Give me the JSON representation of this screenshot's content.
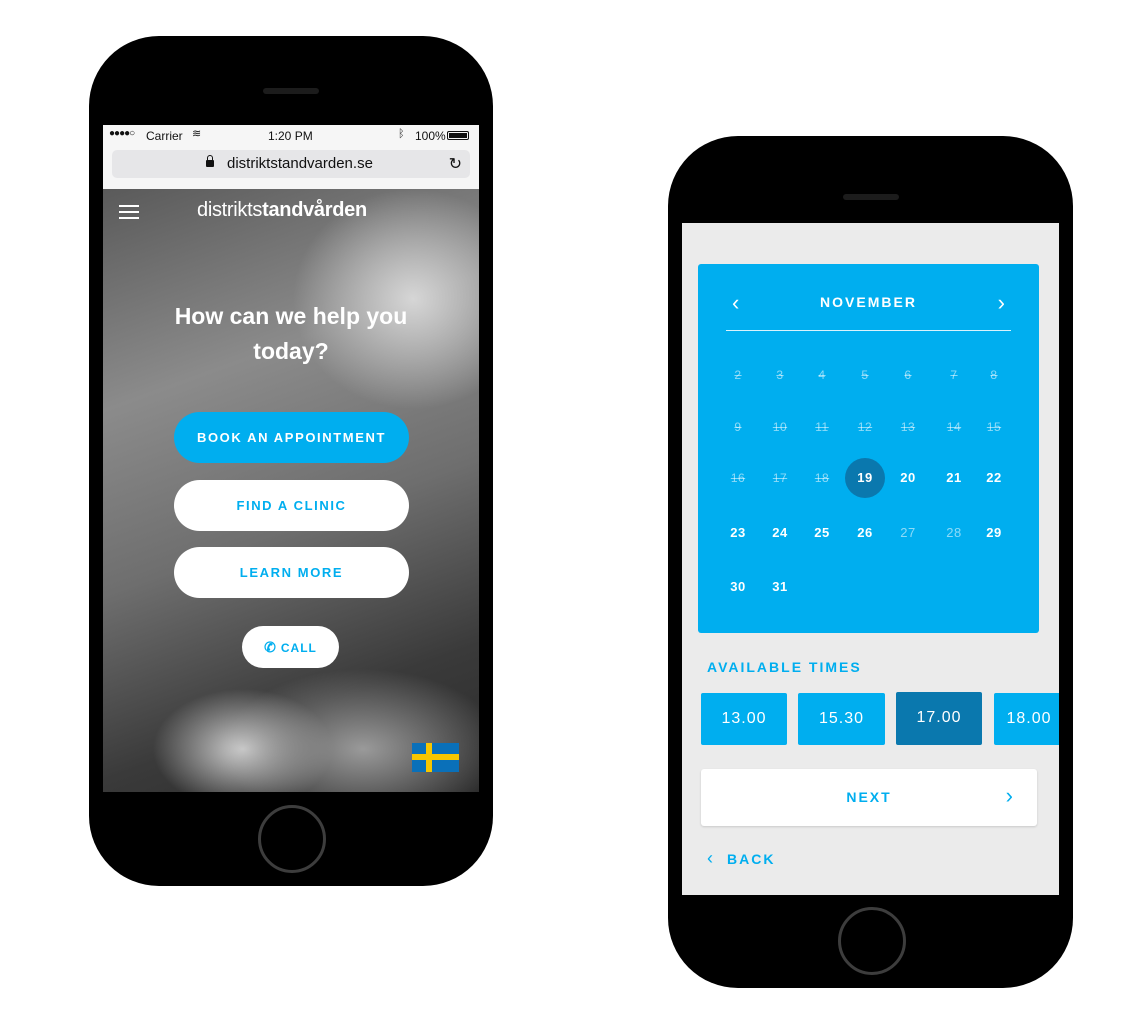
{
  "phone1": {
    "status_bar": {
      "signal": "●●●●○",
      "carrier": "Carrier",
      "wifi_icon": "wifi-icon",
      "time": "1:20 PM",
      "bluetooth_icon": "bluetooth-icon",
      "battery": "100%"
    },
    "browser": {
      "url": "distriktstandvarden.se",
      "reload_glyph": "↻"
    },
    "header": {
      "brand_light": "distrikts",
      "brand_bold": "tandvården"
    },
    "hero": {
      "headline": "How can we help you today?"
    },
    "actions": {
      "book": "BOOK AN APPOINTMENT",
      "find": "FIND A CLINIC",
      "learn": "LEARN MORE",
      "call": "CALL",
      "phone_glyph": "✆"
    },
    "language_flag": "swedish-flag-icon"
  },
  "phone2": {
    "calendar": {
      "month": "NOVEMBER",
      "prev_glyph": "‹",
      "next_glyph": "›",
      "weeks": [
        [
          {
            "d": "2",
            "s": "past"
          },
          {
            "d": "3",
            "s": "past"
          },
          {
            "d": "4",
            "s": "past"
          },
          {
            "d": "5",
            "s": "past"
          },
          {
            "d": "6",
            "s": "past"
          },
          {
            "d": "7",
            "s": "past"
          },
          {
            "d": "8",
            "s": "past"
          }
        ],
        [
          {
            "d": "9",
            "s": "past"
          },
          {
            "d": "10",
            "s": "past"
          },
          {
            "d": "11",
            "s": "past"
          },
          {
            "d": "12",
            "s": "past"
          },
          {
            "d": "13",
            "s": "past"
          },
          {
            "d": "14",
            "s": "past"
          },
          {
            "d": "15",
            "s": "past"
          }
        ],
        [
          {
            "d": "16",
            "s": "past"
          },
          {
            "d": "17",
            "s": "past"
          },
          {
            "d": "18",
            "s": "past"
          },
          {
            "d": "19",
            "s": "selected"
          },
          {
            "d": "20",
            "s": "available"
          },
          {
            "d": "21",
            "s": "available"
          },
          {
            "d": "22",
            "s": "available"
          }
        ],
        [
          {
            "d": "23",
            "s": "available"
          },
          {
            "d": "24",
            "s": "available"
          },
          {
            "d": "25",
            "s": "available"
          },
          {
            "d": "26",
            "s": "available"
          },
          {
            "d": "27",
            "s": "unavailable"
          },
          {
            "d": "28",
            "s": "unavailable"
          },
          {
            "d": "29",
            "s": "available"
          }
        ],
        [
          {
            "d": "30",
            "s": "available"
          },
          {
            "d": "31",
            "s": "available"
          }
        ]
      ]
    },
    "available_times_label": "AVAILABLE TIMES",
    "times": [
      {
        "label": "13.00",
        "selected": false
      },
      {
        "label": "15.30",
        "selected": false
      },
      {
        "label": "17.00",
        "selected": true
      },
      {
        "label": "18.00",
        "selected": false
      }
    ],
    "next_label": "NEXT",
    "next_glyph": "›",
    "back_label": "BACK",
    "back_glyph": "‹"
  },
  "colors": {
    "accent": "#00aeef",
    "accent_dark": "#0a78ae",
    "screen_bg": "#ebebeb"
  }
}
